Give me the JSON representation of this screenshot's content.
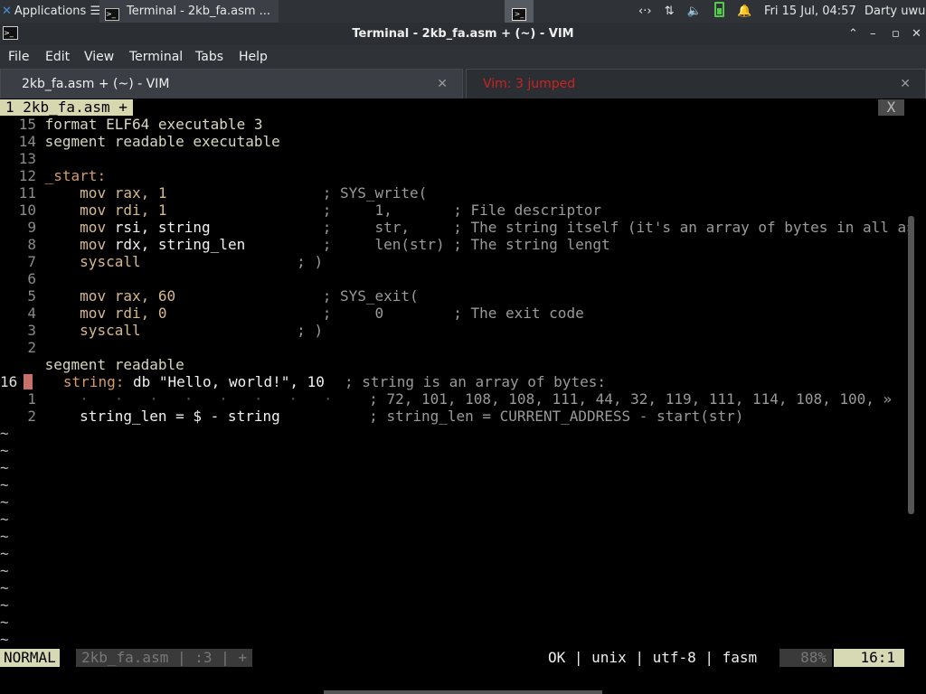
{
  "panel": {
    "applications": "Applications",
    "task_title": "Terminal - 2kb_fa.asm ...",
    "tray_network": "‹·›",
    "tray_transfer": "⇅",
    "tray_volume": "🔈",
    "clock": "Fri 15 Jul, 04:57",
    "user": "Darty uwu"
  },
  "window": {
    "title": "Terminal - 2kb_fa.asm + (~) - VIM"
  },
  "menu": [
    "File",
    "Edit",
    "View",
    "Terminal",
    "Tabs",
    "Help"
  ],
  "tabs": [
    {
      "label": "2kb_fa.asm + (~) - VIM"
    },
    {
      "label": "Vim: 3 jumped"
    }
  ],
  "vim": {
    "buffer_tab": "1 2kb_fa.asm +",
    "buffer_close": "X",
    "lines": {
      "l1": {
        "n": "15",
        "text": "format ELF64 executable 3"
      },
      "l2": {
        "n": "14",
        "text": "segment readable executable"
      },
      "l3": {
        "n": "13"
      },
      "l4": {
        "n": "12",
        "label": "_start:"
      },
      "l5": {
        "n": "11",
        "ins": "mov",
        "args": "rax, 1",
        "cmt": "; SYS_write("
      },
      "l6": {
        "n": "10",
        "ins": "mov",
        "args": "rdi, 1",
        "cmt": ";     1,       ; File descriptor"
      },
      "l7": {
        "n": "9",
        "ins": "mov",
        "args": "rsi, string",
        "cmt": ";     str,     ; The string itself (it's an array of bytes in all a»"
      },
      "l8": {
        "n": "8",
        "ins": "mov",
        "args": "rdx, string_len",
        "cmt": ";     len(str) ; The string lengt"
      },
      "l9": {
        "n": "7",
        "ins": "syscall",
        "cmt": "; )"
      },
      "l10": {
        "n": "6"
      },
      "l11": {
        "n": "5",
        "ins": "mov",
        "args": "rax, 60",
        "cmt": "; SYS_exit("
      },
      "l12": {
        "n": "4",
        "ins": "mov",
        "args": "rdi, 0",
        "cmt": ";     0        ; The exit code"
      },
      "l13": {
        "n": "3",
        "ins": "syscall",
        "cmt": "; )"
      },
      "l14": {
        "n": "2"
      },
      "l15": {
        "n": "",
        "text": "segment readable"
      },
      "l16": {
        "n": "16",
        "label": "string:",
        "body": "db \"Hello, world!\", 10",
        "cmt": "; string is an array of bytes:"
      },
      "l17": {
        "n": "1",
        "dots": "·   ·   ·   ·   ·   ·   ·   ·",
        "cmt": "; 72, 101, 108, 108, 111, 44, 32, 119, 111, 114, 108, 100, »"
      },
      "l18": {
        "n": "2",
        "body": "string_len = $ - string",
        "cmt": "; string_len = CURRENT_ADDRESS - start(str)"
      }
    },
    "tilde": "~"
  },
  "statusline": {
    "mode": "NORMAL",
    "file": "2kb_fa.asm | :3 | +",
    "info": "OK | unix | utf-8 | fasm",
    "percent": "88%",
    "position": "16:1"
  }
}
